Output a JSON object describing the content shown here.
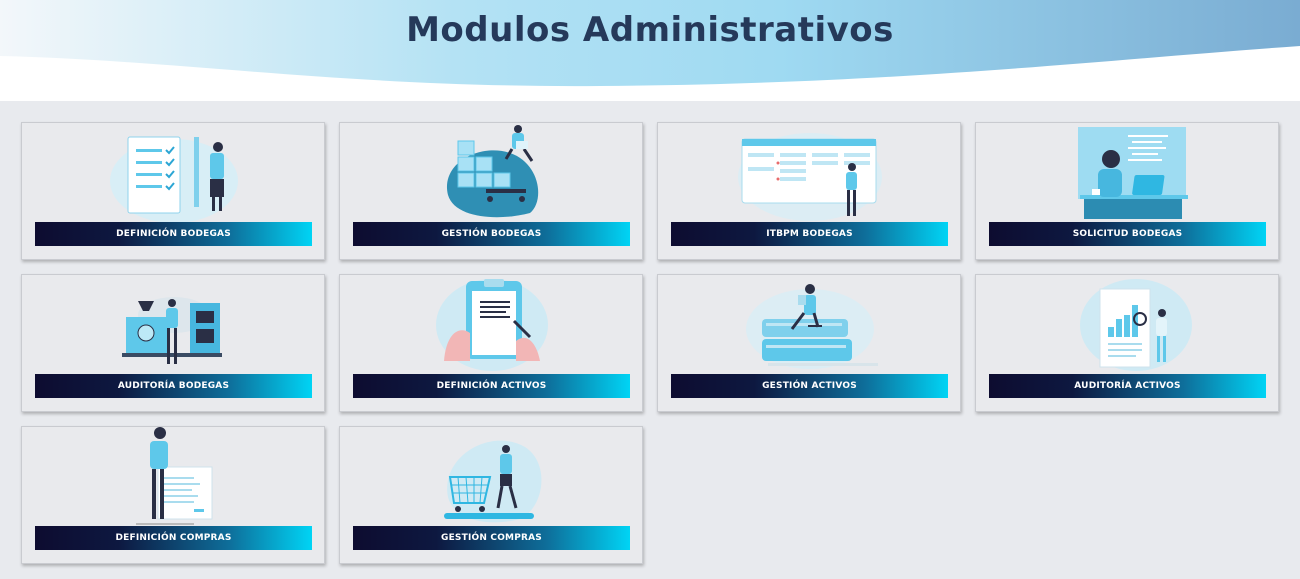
{
  "header": {
    "title": "Modulos Administrativos"
  },
  "colors": {
    "accent": "#5ec8ea",
    "title": "#25395a",
    "bar_start": "#0d0c30",
    "bar_end": "#00d4f5"
  },
  "modules": [
    {
      "label": "DEFINICIÓN BODEGAS",
      "icon": "checklist-illustration"
    },
    {
      "label": "GESTIÓN BODEGAS",
      "icon": "boxes-illustration"
    },
    {
      "label": "ITBPM BODEGAS",
      "icon": "kanban-board-illustration"
    },
    {
      "label": "SOLICITUD BODEGAS",
      "icon": "desk-computer-illustration"
    },
    {
      "label": "AUDITORÍA BODEGAS",
      "icon": "factory-illustration"
    },
    {
      "label": "DEFINICIÓN ACTIVOS",
      "icon": "clipboard-illustration"
    },
    {
      "label": "GESTIÓN ACTIVOS",
      "icon": "books-reader-illustration"
    },
    {
      "label": "AUDITORÍA ACTIVOS",
      "icon": "document-magnifier-illustration"
    },
    {
      "label": "DEFINICIÓN COMPRAS",
      "icon": "presentation-board-illustration"
    },
    {
      "label": "GESTIÓN COMPRAS",
      "icon": "shopping-cart-illustration"
    }
  ]
}
